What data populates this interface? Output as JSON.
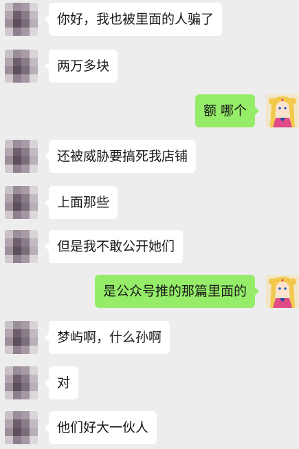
{
  "messages": [
    {
      "side": "left",
      "text": "你好，我也被里面的人骗了"
    },
    {
      "side": "left",
      "text": "两万多块"
    },
    {
      "side": "right",
      "text": "额 哪个"
    },
    {
      "side": "left",
      "text": "还被威胁要搞死我店铺"
    },
    {
      "side": "left",
      "text": "上面那些"
    },
    {
      "side": "left",
      "text": "但是我不敢公开她们"
    },
    {
      "side": "right",
      "text": "是公众号推的那篇里面的"
    },
    {
      "side": "left",
      "text": "梦屿啊，什么孙啊"
    },
    {
      "side": "left",
      "text": "对"
    },
    {
      "side": "left",
      "text": "他们好大一伙人"
    }
  ],
  "colors": {
    "background": "#ededed",
    "incoming_bubble": "#ffffff",
    "outgoing_bubble": "#95ec69"
  },
  "icons": {
    "contact_avatar": "blurred-contact-avatar-icon",
    "self_avatar": "anime-character-avatar-icon"
  }
}
